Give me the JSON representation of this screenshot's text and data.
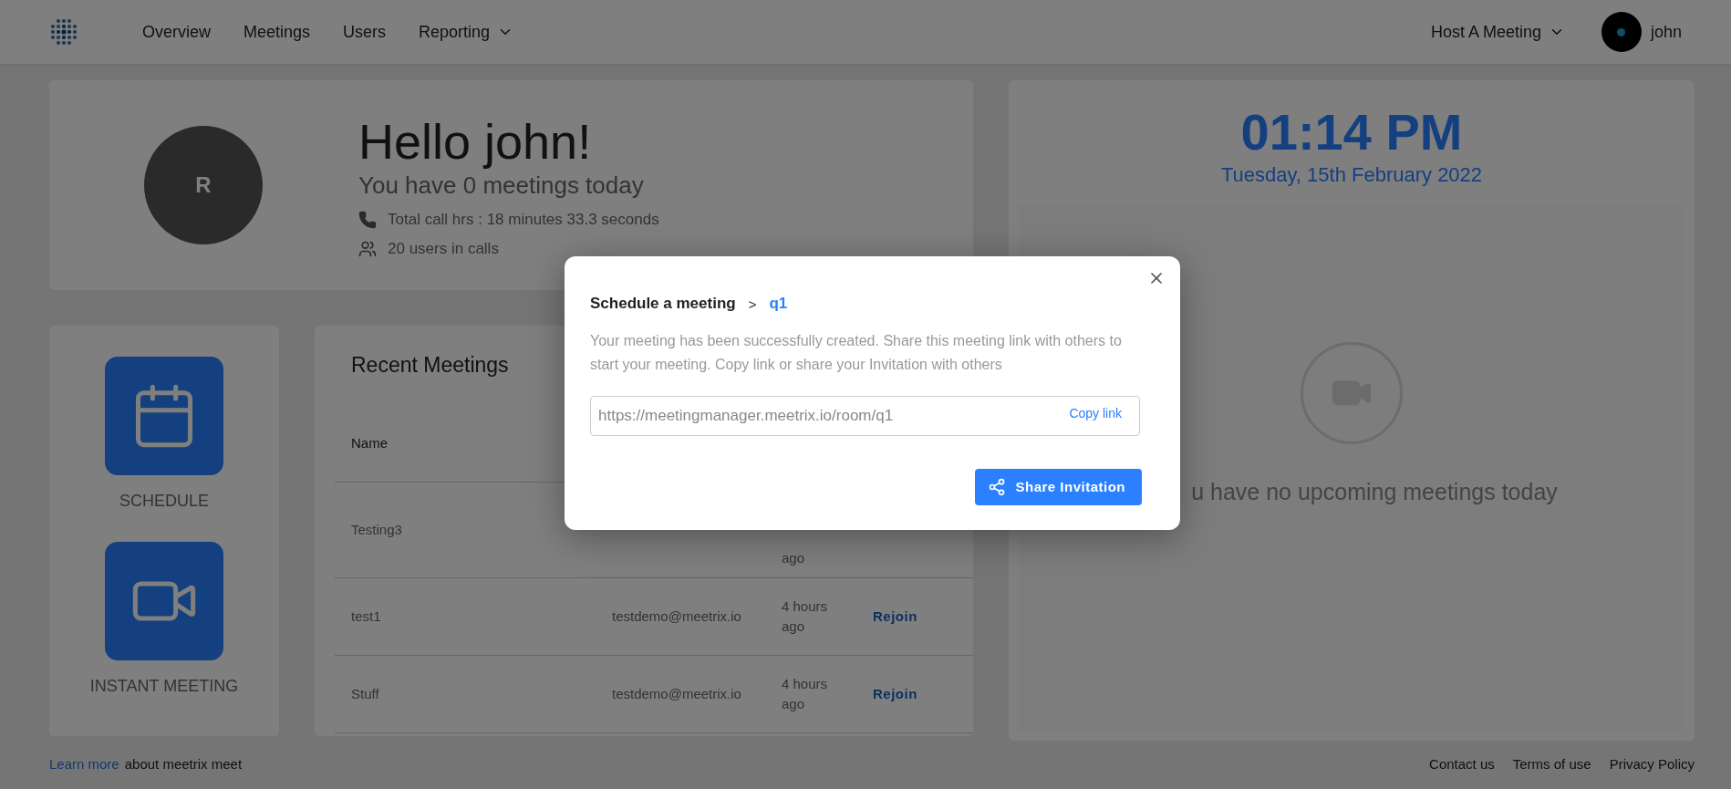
{
  "nav_items": [
    {
      "label": "Overview",
      "kind": "link"
    },
    {
      "label": "Meetings",
      "kind": "link"
    },
    {
      "label": "Users",
      "kind": "link"
    },
    {
      "label": "Reporting",
      "kind": "menu"
    }
  ],
  "host_menu": {
    "label": "Host A Meeting"
  },
  "user": {
    "name": "john"
  },
  "greeting": {
    "avatar_initial": "R",
    "title": "Hello john!",
    "subtitle": "You have 0 meetings today",
    "stats": [
      {
        "kind": "phone",
        "text": "Total call hrs : 18 minutes 33.3 seconds"
      },
      {
        "kind": "users",
        "text": "20 users in calls"
      }
    ]
  },
  "actions": [
    {
      "kind": "calendar",
      "label": "SCHEDULE"
    },
    {
      "kind": "video",
      "label": "INSTANT MEETING"
    }
  ],
  "recent_meetings": {
    "title": "Recent Meetings",
    "columns": [
      "Name"
    ],
    "rows": [
      {
        "name": "Testing3",
        "time": "ago"
      },
      {
        "name": "test1",
        "email": "testdemo@meetrix.io",
        "time": "4 hours ago",
        "action": "Rejoin"
      },
      {
        "name": "Stuff",
        "email": "testdemo@meetrix.io",
        "time": "4 hours ago",
        "action": "Rejoin"
      }
    ]
  },
  "clock": {
    "time": "01:14 PM",
    "date": "Tuesday, 15th February 2022"
  },
  "upcoming": {
    "empty_text": "u have no upcoming meetings today"
  },
  "footer": {
    "learn_more": "Learn more",
    "about": "about meetrix meet",
    "links": [
      "Contact us",
      "Terms of use",
      "Privacy Policy"
    ]
  },
  "modal": {
    "title": "Schedule a meeting",
    "separator": ">",
    "meeting": "q1",
    "message": "Your meeting has been successfully created. Share this meeting link with others to start your meeting. Copy link or share your Invitation with others",
    "link": "https://meetingmanager.meetrix.io/room/q1",
    "copy_label": "Copy link",
    "share_label": "Share Invitation"
  }
}
